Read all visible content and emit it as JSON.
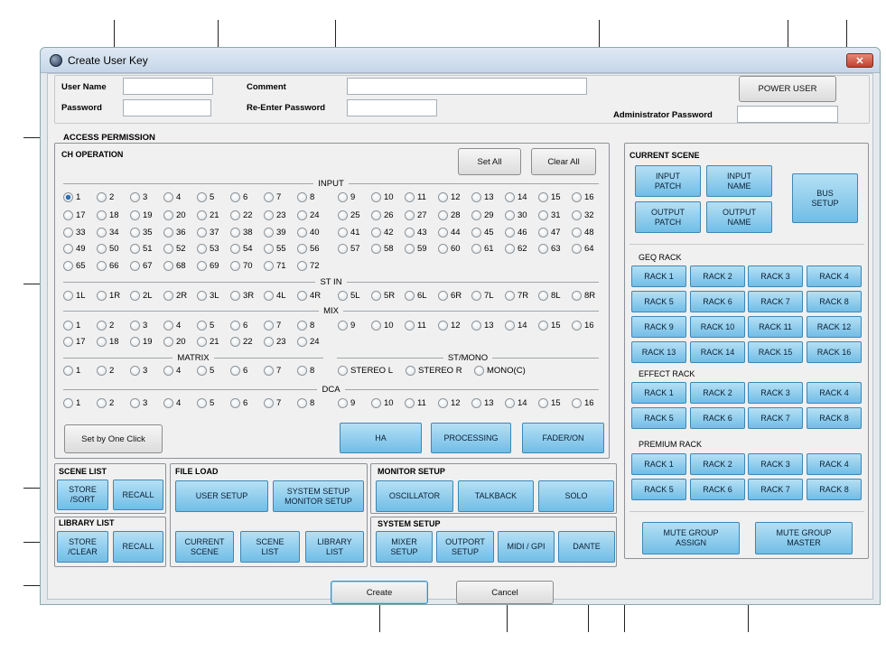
{
  "window": {
    "title": "Create User Key",
    "close_label": "✕"
  },
  "fields": {
    "user_name": "User Name",
    "password": "Password",
    "comment": "Comment",
    "reenter_password": "Re-Enter Password",
    "admin_password": "Administrator Password"
  },
  "power_user_label": "POWER USER",
  "access_permission_label": "ACCESS PERMISSION",
  "ch": {
    "title": "CH OPERATION",
    "set_all": "Set All",
    "clear_all": "Clear All",
    "input_label": "INPUT",
    "input_rows": [
      [
        "1",
        "2",
        "3",
        "4",
        "5",
        "6",
        "7",
        "8",
        "9",
        "10",
        "11",
        "12",
        "13",
        "14",
        "15",
        "16"
      ],
      [
        "17",
        "18",
        "19",
        "20",
        "21",
        "22",
        "23",
        "24",
        "25",
        "26",
        "27",
        "28",
        "29",
        "30",
        "31",
        "32"
      ],
      [
        "33",
        "34",
        "35",
        "36",
        "37",
        "38",
        "39",
        "40",
        "41",
        "42",
        "43",
        "44",
        "45",
        "46",
        "47",
        "48"
      ],
      [
        "49",
        "50",
        "51",
        "52",
        "53",
        "54",
        "55",
        "56",
        "57",
        "58",
        "59",
        "60",
        "61",
        "62",
        "63",
        "64"
      ],
      [
        "65",
        "66",
        "67",
        "68",
        "69",
        "70",
        "71",
        "72"
      ]
    ],
    "stin_label": "ST IN",
    "stin_row": [
      "1L",
      "1R",
      "2L",
      "2R",
      "3L",
      "3R",
      "4L",
      "4R",
      "5L",
      "5R",
      "6L",
      "6R",
      "7L",
      "7R",
      "8L",
      "8R"
    ],
    "mix_label": "MIX",
    "mix_rows": [
      [
        "1",
        "2",
        "3",
        "4",
        "5",
        "6",
        "7",
        "8",
        "9",
        "10",
        "11",
        "12",
        "13",
        "14",
        "15",
        "16"
      ],
      [
        "17",
        "18",
        "19",
        "20",
        "21",
        "22",
        "23",
        "24"
      ]
    ],
    "matrix_label": "MATRIX",
    "matrix_row": [
      "1",
      "2",
      "3",
      "4",
      "5",
      "6",
      "7",
      "8"
    ],
    "stmono_label": "ST/MONO",
    "stmono_row": [
      "STEREO L",
      "STEREO R",
      "MONO(C)"
    ],
    "dca_label": "DCA",
    "dca_row": [
      "1",
      "2",
      "3",
      "4",
      "5",
      "6",
      "7",
      "8",
      "9",
      "10",
      "11",
      "12",
      "13",
      "14",
      "15",
      "16"
    ],
    "set_by_one_click": "Set by One Click",
    "ha": "HA",
    "processing": "PROCESSING",
    "fader_on": "FADER/ON"
  },
  "scene_list": {
    "title": "SCENE LIST",
    "store_sort": "STORE\n/SORT",
    "recall": "RECALL"
  },
  "library_list": {
    "title": "LIBRARY LIST",
    "store_clear": "STORE\n/CLEAR",
    "recall": "RECALL"
  },
  "file_load": {
    "title": "FILE LOAD",
    "user_setup": "USER SETUP",
    "system_setup_monitor": "SYSTEM SETUP\nMONITOR SETUP",
    "current_scene": "CURRENT\nSCENE",
    "scene_list": "SCENE\nLIST",
    "library_list": "LIBRARY\nLIST"
  },
  "monitor_setup": {
    "title": "MONITOR SETUP",
    "oscillator": "OSCILLATOR",
    "talkback": "TALKBACK",
    "solo": "SOLO"
  },
  "system_setup": {
    "title": "SYSTEM SETUP",
    "mixer_setup": "MIXER\nSETUP",
    "outport_setup": "OUTPORT\nSETUP",
    "midi_gpi": "MIDI / GPI",
    "dante": "DANTE"
  },
  "current_scene": {
    "title": "CURRENT SCENE",
    "input_patch": "INPUT\nPATCH",
    "input_name": "INPUT\nNAME",
    "output_patch": "OUTPUT\nPATCH",
    "output_name": "OUTPUT\nNAME",
    "bus_setup": "BUS\nSETUP",
    "geq_label": "GEQ RACK",
    "geq": [
      "RACK 1",
      "RACK 2",
      "RACK 3",
      "RACK 4",
      "RACK 5",
      "RACK 6",
      "RACK 7",
      "RACK 8",
      "RACK 9",
      "RACK 10",
      "RACK 11",
      "RACK 12",
      "RACK 13",
      "RACK 14",
      "RACK 15",
      "RACK 16"
    ],
    "effect_label": "EFFECT RACK",
    "effect": [
      "RACK 1",
      "RACK 2",
      "RACK 3",
      "RACK 4",
      "RACK 5",
      "RACK 6",
      "RACK 7",
      "RACK 8"
    ],
    "premium_label": "PREMIUM RACK",
    "premium": [
      "RACK 1",
      "RACK 2",
      "RACK 3",
      "RACK 4",
      "RACK 5",
      "RACK 6",
      "RACK 7",
      "RACK 8"
    ],
    "mute_assign": "MUTE GROUP\nASSIGN",
    "mute_master": "MUTE GROUP\nMASTER"
  },
  "create": "Create",
  "cancel": "Cancel"
}
